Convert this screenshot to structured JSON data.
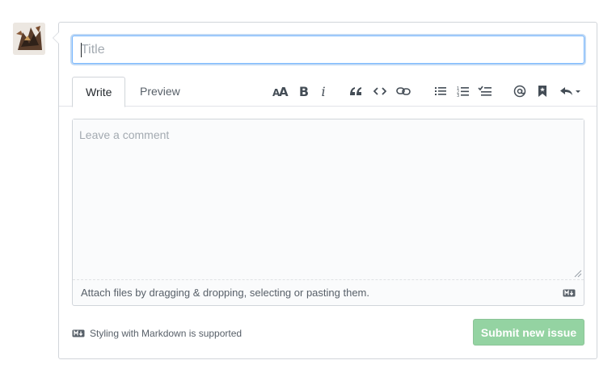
{
  "form": {
    "title_placeholder": "Title",
    "tabs": [
      {
        "label": "Write",
        "active": true
      },
      {
        "label": "Preview",
        "active": false
      }
    ],
    "toolbar": {
      "header_icon": "text-size-icon",
      "bold_label": "B",
      "italic_label": "i",
      "icons": [
        "text-size-icon",
        "bold-icon",
        "italic-icon",
        "quote-icon",
        "code-icon",
        "link-icon",
        "unordered-list-icon",
        "ordered-list-icon",
        "task-list-icon",
        "mention-icon",
        "bookmark-icon",
        "reply-icon"
      ]
    },
    "comment_placeholder": "Leave a comment",
    "attach_text": "Attach files by dragging & dropping, selecting or pasting them.",
    "markdown_note": "Styling with Markdown is supported",
    "submit_label": "Submit new issue"
  },
  "colors": {
    "submit_bg": "#94d3a2",
    "focus_border": "#79b8ff",
    "border": "#d1d5da"
  }
}
